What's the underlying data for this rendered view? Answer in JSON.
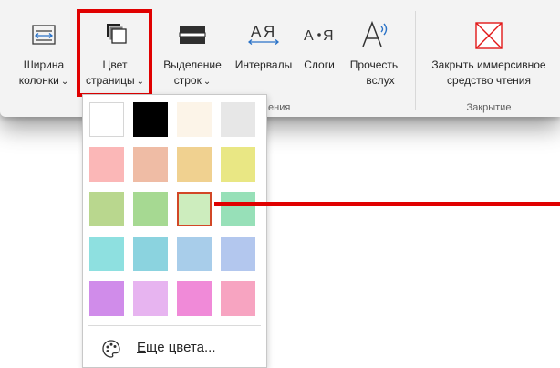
{
  "ribbon": {
    "buttons": {
      "column_width": {
        "line1": "Ширина",
        "line2": "колонки"
      },
      "page_color": {
        "line1": "Цвет",
        "line2": "страницы"
      },
      "line_focus": {
        "line1": "Выделение",
        "line2": "строк"
      },
      "spacing": {
        "line1": "Интервалы"
      },
      "syllables": {
        "line1": "Слоги"
      },
      "read_aloud": {
        "line1": "Прочесть",
        "line2": "вслух"
      },
      "close_reader": {
        "line1": "Закрыть иммерсивное",
        "line2": "средство чтения"
      }
    },
    "chevron": "⌄",
    "groups": {
      "options_partial": "ения",
      "close": "Закрытие"
    }
  },
  "page_color_menu": {
    "swatches": [
      {
        "color": "#ffffff",
        "name": "white"
      },
      {
        "color": "#000000",
        "name": "black"
      },
      {
        "color": "#fcf4e8",
        "name": "cream"
      },
      {
        "color": "#e7e7e7",
        "name": "light-gray"
      },
      {
        "color": "#fbb7b7",
        "name": "light-pink"
      },
      {
        "color": "#efbca5",
        "name": "peach"
      },
      {
        "color": "#f0d190",
        "name": "light-orange"
      },
      {
        "color": "#e9e784",
        "name": "light-yellow"
      },
      {
        "color": "#b9d78e",
        "name": "olive-green"
      },
      {
        "color": "#a6d992",
        "name": "light-green"
      },
      {
        "color": "#cdedbe",
        "name": "mint-selected"
      },
      {
        "color": "#97e0b8",
        "name": "sea-green"
      },
      {
        "color": "#8ee0e0",
        "name": "aqua"
      },
      {
        "color": "#8bd3df",
        "name": "light-teal"
      },
      {
        "color": "#a8cdea",
        "name": "light-blue"
      },
      {
        "color": "#b3c7ee",
        "name": "periwinkle"
      },
      {
        "color": "#d08cea",
        "name": "lilac"
      },
      {
        "color": "#e7b4f0",
        "name": "light-lilac"
      },
      {
        "color": "#f08ad8",
        "name": "pink"
      },
      {
        "color": "#f7a4c1",
        "name": "rose"
      }
    ],
    "selected_index": 10,
    "more_colors": {
      "accel": "Е",
      "rest": "ще цвета..."
    }
  },
  "colors": {
    "highlight_red": "#e00000",
    "selection_border": "#d24726",
    "close_icon_red": "#e21818"
  }
}
